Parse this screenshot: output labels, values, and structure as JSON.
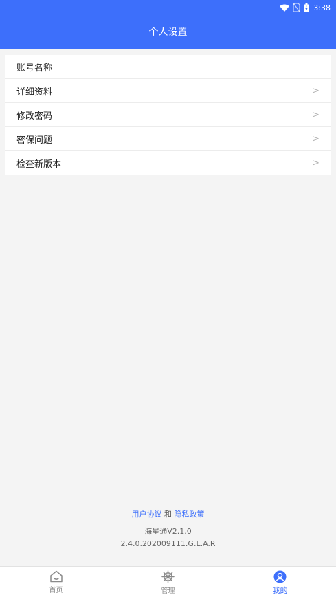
{
  "status_bar": {
    "time": "3:38"
  },
  "header": {
    "title": "个人设置"
  },
  "menu": {
    "items": [
      {
        "label": "账号名称",
        "has_chevron": false
      },
      {
        "label": "详细资料",
        "has_chevron": true
      },
      {
        "label": "修改密码",
        "has_chevron": true
      },
      {
        "label": "密保问题",
        "has_chevron": true
      },
      {
        "label": "检查新版本",
        "has_chevron": true
      }
    ],
    "chevron": ">"
  },
  "footer": {
    "user_agreement": "用户协议",
    "and": "和",
    "privacy_policy": "隐私政策",
    "app_version": "海星通V2.1.0",
    "build_version": "2.4.0.202009111.G.L.A.R"
  },
  "tabbar": {
    "tabs": [
      {
        "label": "首页",
        "icon": "home-icon",
        "active": false
      },
      {
        "label": "管理",
        "icon": "helm-wheel-icon",
        "active": false
      },
      {
        "label": "我的",
        "icon": "user-profile-icon",
        "active": true
      }
    ]
  },
  "colors": {
    "brand": "#3d6ffb",
    "background": "#f4f4f4"
  }
}
